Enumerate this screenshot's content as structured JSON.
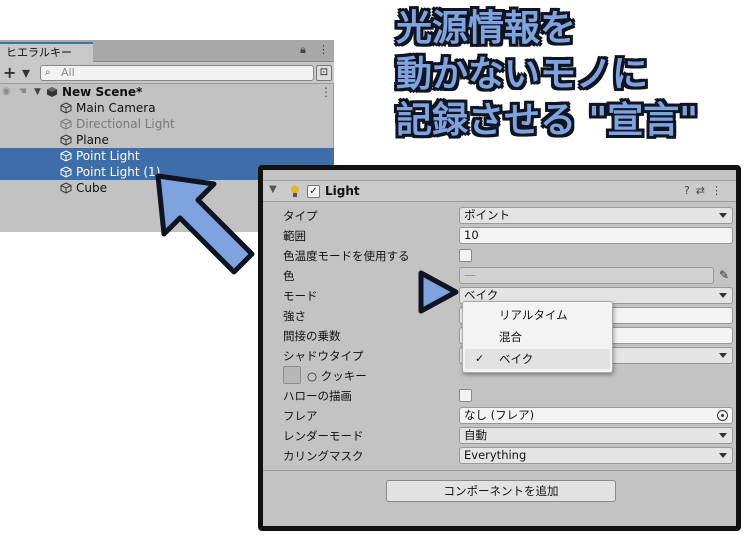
{
  "hierarchy": {
    "tab_label": "ヒエラルキー",
    "add_label": "+ ▾",
    "search_placeholder": "All",
    "scene_name": "New Scene*",
    "items": [
      {
        "label": "Main Camera",
        "state": "normal"
      },
      {
        "label": "Directional Light",
        "state": "disabled"
      },
      {
        "label": "Plane",
        "state": "normal"
      },
      {
        "label": "Point Light",
        "state": "selected"
      },
      {
        "label": "Point Light (1)",
        "state": "selected"
      },
      {
        "label": "Cube",
        "state": "normal"
      }
    ]
  },
  "annotation": {
    "lines": [
      "光源情報を",
      "動かないモノに",
      "記録させる \"宣言\""
    ],
    "color": "#7ea3de"
  },
  "inspector": {
    "component_title": "Light",
    "properties": {
      "type": {
        "label": "タイプ",
        "value": "ポイント"
      },
      "range": {
        "label": "範囲",
        "value": "10"
      },
      "use_color_temp": {
        "label": "色温度モードを使用する"
      },
      "color": {
        "label": "色",
        "value": "—"
      },
      "mode": {
        "label": "モード",
        "value": "ベイク"
      },
      "intensity": {
        "label": "強さ"
      },
      "indirect": {
        "label": "間接の乗数"
      },
      "shadow_type": {
        "label": "シャドウタイプ"
      },
      "cookie": {
        "label": "○ クッキー"
      },
      "draw_halo": {
        "label": "ハローの描画"
      },
      "flare": {
        "label": "フレア",
        "value": "なし (フレア)"
      },
      "render_mode": {
        "label": "レンダーモード",
        "value": "自動"
      },
      "culling_mask": {
        "label": "カリングマスク",
        "value": "Everything"
      }
    },
    "mode_menu": {
      "options": [
        "リアルタイム",
        "混合",
        "ベイク"
      ],
      "selected": "ベイク"
    },
    "add_component_label": "コンポーネントを追加"
  },
  "colors": {
    "selection": "#3e6ea9",
    "arrow_fill": "#7ea3de",
    "arrow_outline": "#0f1420"
  }
}
